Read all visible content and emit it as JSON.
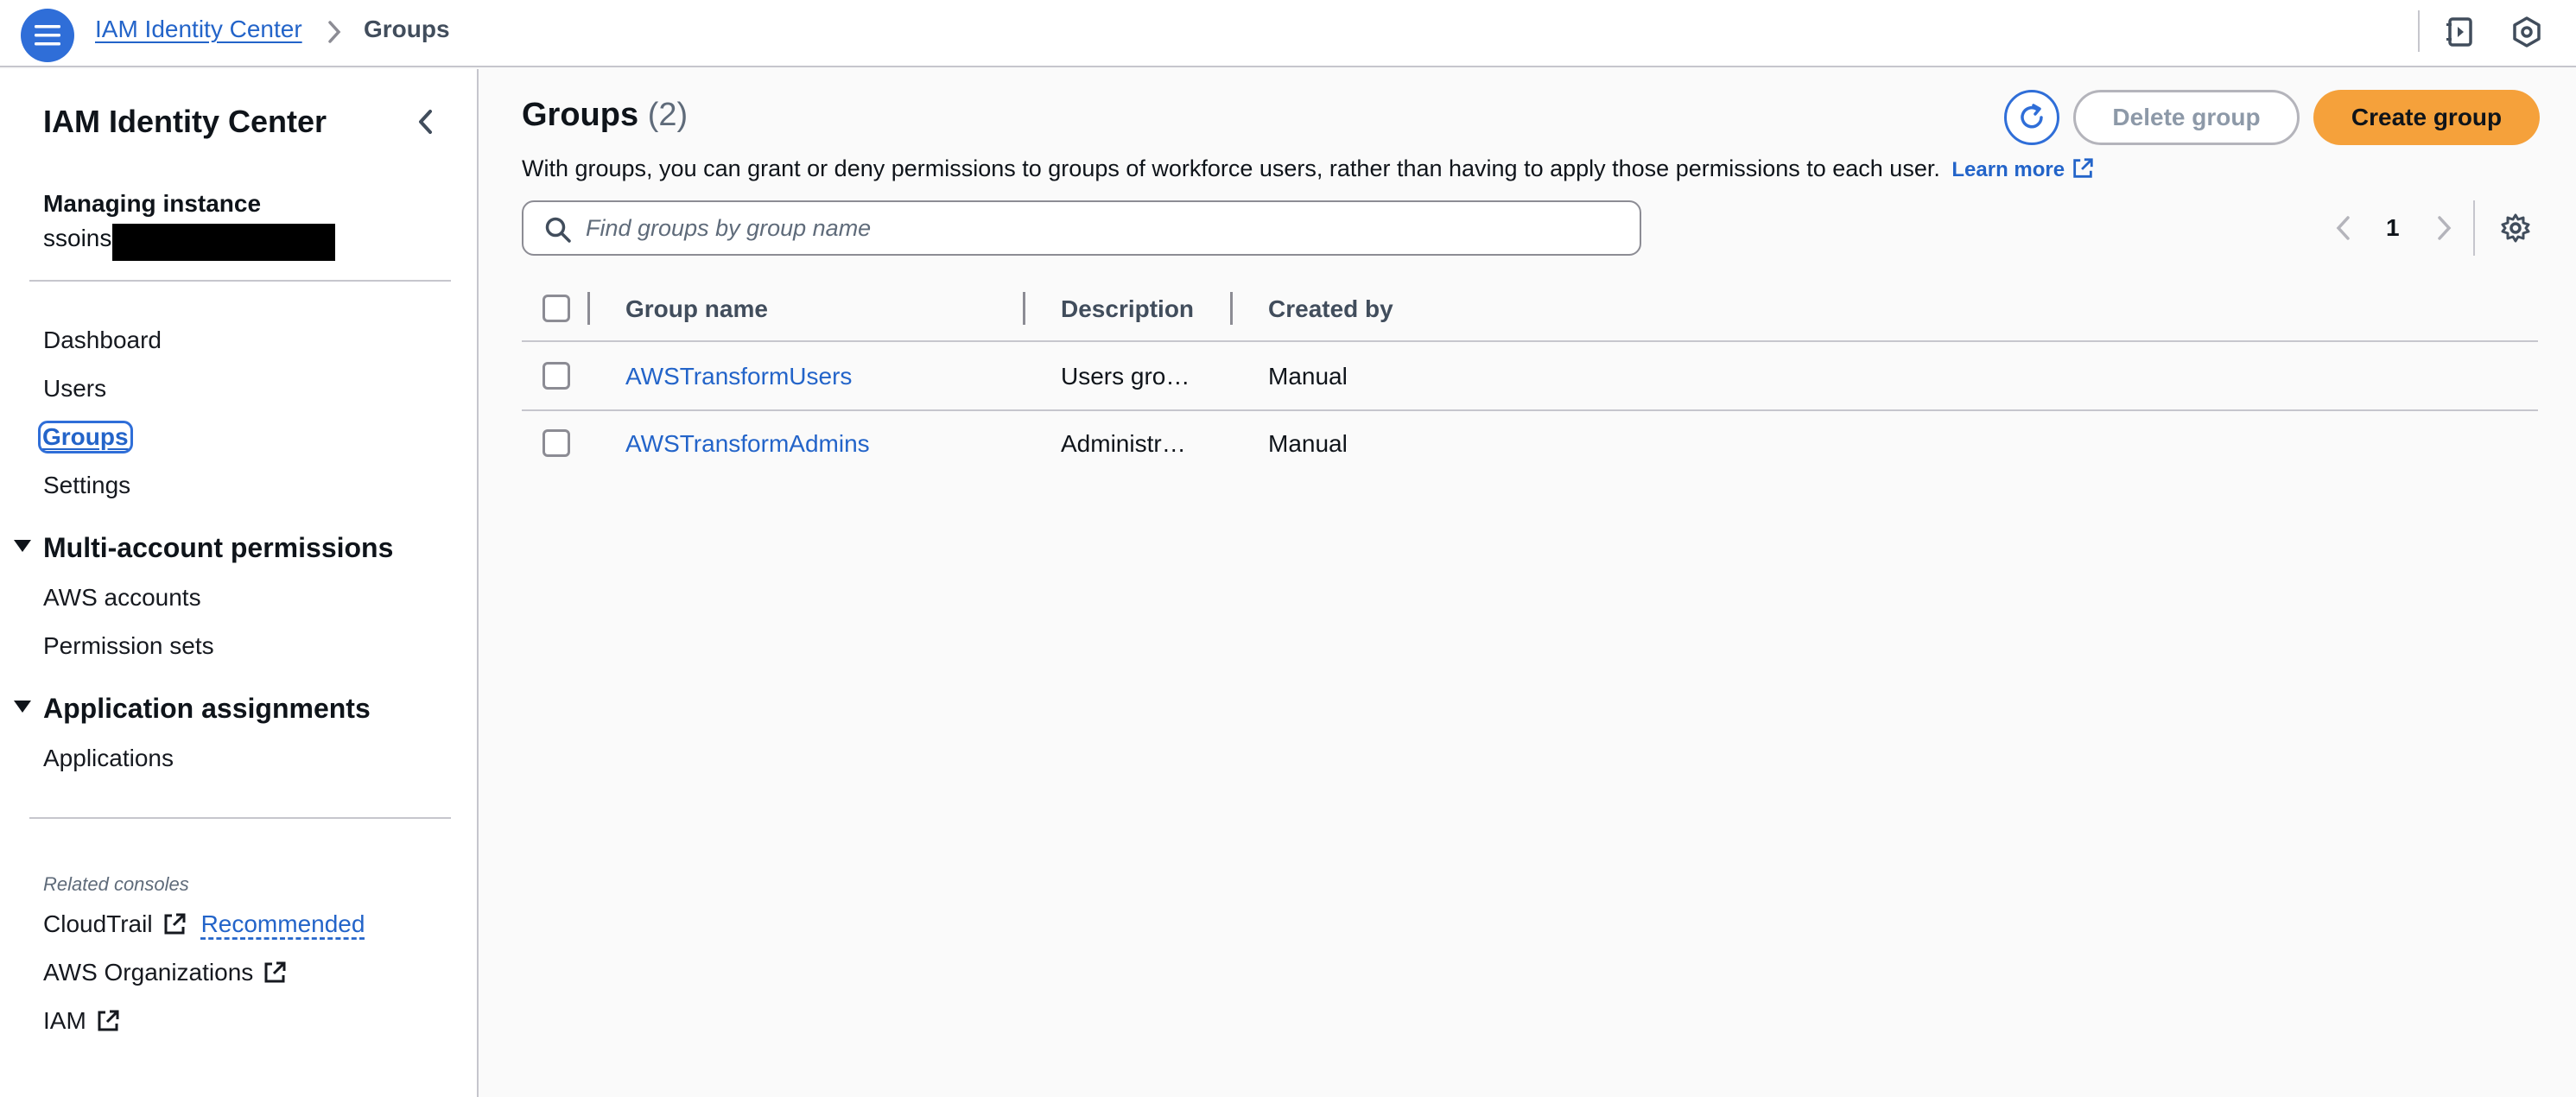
{
  "breadcrumb": {
    "service": "IAM Identity Center",
    "current": "Groups"
  },
  "sidebar": {
    "title": "IAM Identity Center",
    "managing_label": "Managing instance",
    "instance_prefix": "ssoins-",
    "nav": [
      {
        "label": "Dashboard"
      },
      {
        "label": "Users"
      },
      {
        "label": "Groups",
        "active": true
      },
      {
        "label": "Settings"
      }
    ],
    "sections": [
      {
        "title": "Multi-account permissions",
        "items": [
          {
            "label": "AWS accounts"
          },
          {
            "label": "Permission sets"
          }
        ]
      },
      {
        "title": "Application assignments",
        "items": [
          {
            "label": "Applications"
          }
        ]
      }
    ],
    "related_label": "Related consoles",
    "related": [
      {
        "label": "CloudTrail",
        "badge": "Recommended"
      },
      {
        "label": "AWS Organizations"
      },
      {
        "label": "IAM"
      }
    ]
  },
  "main": {
    "title": "Groups",
    "count": "(2)",
    "description": "With groups, you can grant or deny permissions to groups of workforce users, rather than having to apply those permissions to each user.",
    "learn_more": "Learn more",
    "buttons": {
      "delete": "Delete group",
      "create": "Create group"
    },
    "search": {
      "placeholder": "Find groups by group name",
      "value": ""
    },
    "pagination": {
      "current_page": "1"
    },
    "table": {
      "columns": [
        "Group name",
        "Description",
        "Created by"
      ],
      "rows": [
        {
          "name": "AWSTransformUsers",
          "description": "Users gro…",
          "created_by": "Manual"
        },
        {
          "name": "AWSTransformAdmins",
          "description": "Administr…",
          "created_by": "Manual"
        }
      ]
    }
  },
  "icons": {
    "menu": "menu-icon",
    "breadcrumb_separator": "chevron-right-icon",
    "top_right": [
      "notes-panel-icon",
      "settings-hexagon-icon"
    ],
    "refresh": "refresh-icon",
    "search": "search-icon",
    "external": "external-link-icon",
    "preferences": "gear-icon"
  },
  "colors": {
    "link": "#2364c9",
    "primary_button": "#f5a13b",
    "accent": "#2f6ed8"
  }
}
